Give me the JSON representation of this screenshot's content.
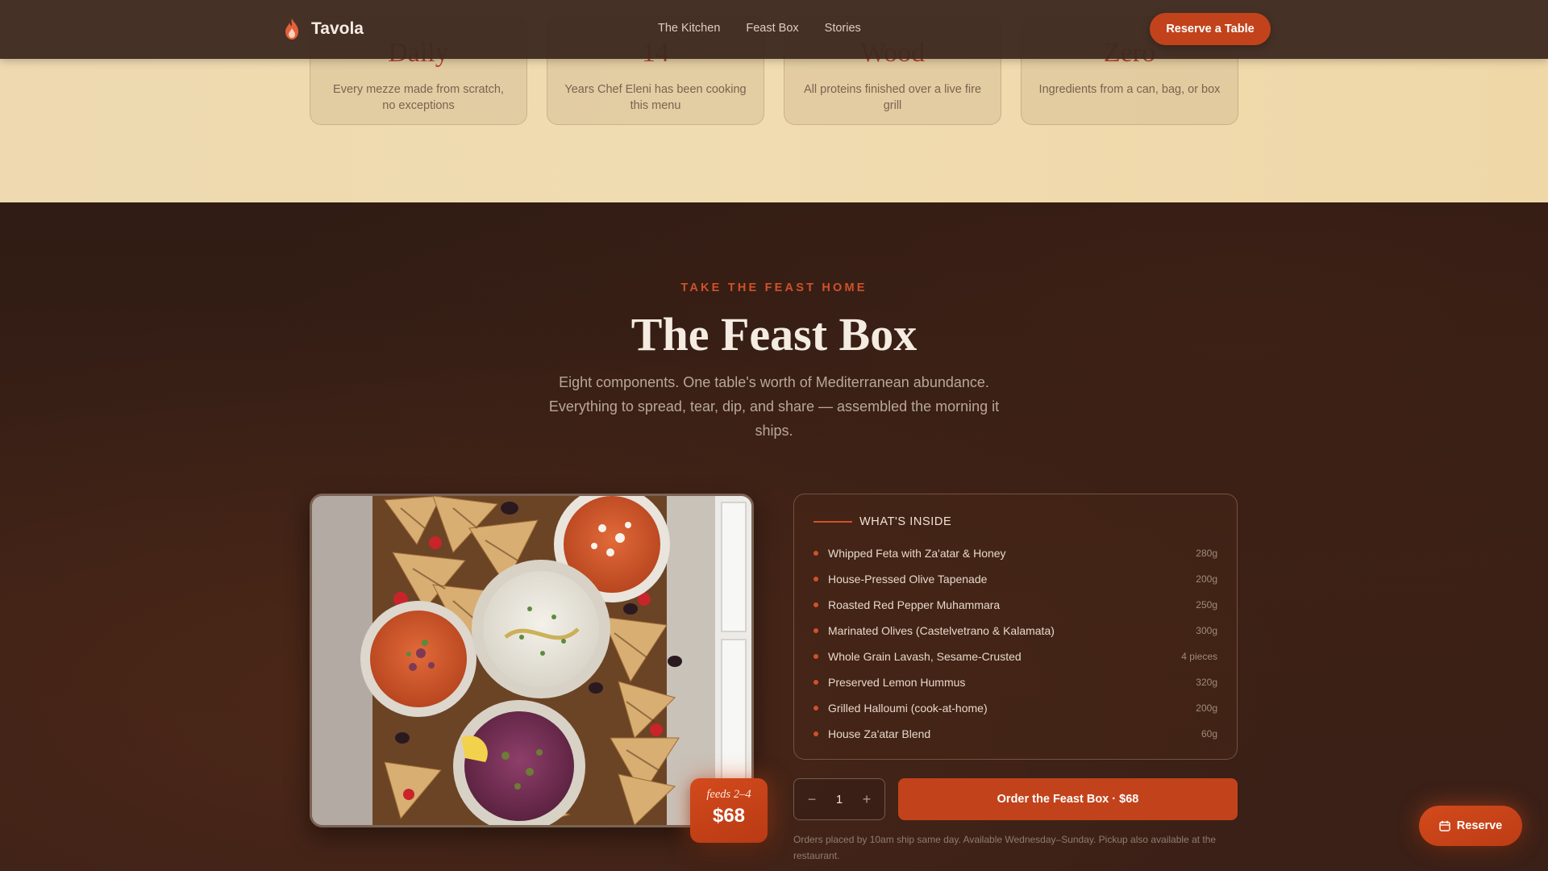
{
  "header": {
    "brand": "Tavola",
    "nav": [
      "The Kitchen",
      "Feast Box",
      "Stories"
    ],
    "cta": "Reserve a Table"
  },
  "stats": [
    {
      "value": "Daily",
      "desc": "Every mezze made from scratch, no exceptions"
    },
    {
      "value": "14",
      "desc": "Years Chef Eleni has been cooking this menu"
    },
    {
      "value": "Wood",
      "desc": "All proteins finished over a live fire grill"
    },
    {
      "value": "Zero",
      "desc": "Ingredients from a can, bag, or box"
    }
  ],
  "feast": {
    "eyebrow": "TAKE THE FEAST HOME",
    "title": "The Feast Box",
    "subtitle": "Eight components. One table's worth of Mediterranean abundance. Everything to spread, tear, dip, and share — assembled the morning it ships.",
    "badge": {
      "feeds": "feeds 2–4",
      "price": "$68"
    },
    "inside_label": "WHAT'S INSIDE",
    "items": [
      {
        "name": "Whipped Feta with Za'atar & Honey",
        "amount": "280g"
      },
      {
        "name": "House-Pressed Olive Tapenade",
        "amount": "200g"
      },
      {
        "name": "Roasted Red Pepper Muhammara",
        "amount": "250g"
      },
      {
        "name": "Marinated Olives (Castelvetrano & Kalamata)",
        "amount": "300g"
      },
      {
        "name": "Whole Grain Lavash, Sesame-Crusted",
        "amount": "4 pieces"
      },
      {
        "name": "Preserved Lemon Hummus",
        "amount": "320g"
      },
      {
        "name": "Grilled Halloumi (cook-at-home)",
        "amount": "200g"
      },
      {
        "name": "House Za'atar Blend",
        "amount": "60g"
      }
    ],
    "quantity": {
      "minus": "−",
      "value": "1",
      "plus": "+"
    },
    "order_label": "Order the Feast Box · $68",
    "note": "Orders placed by 10am ship same day. Available Wednesday–Sunday. Pickup also available at the restaurant."
  },
  "floating": {
    "label": "Reserve",
    "icon": "calendar-icon"
  },
  "colors": {
    "accent": "#c2431b",
    "header_bg": "#3e2a20",
    "band_bg": "#efd8ad",
    "section_bg": "#321d14"
  }
}
